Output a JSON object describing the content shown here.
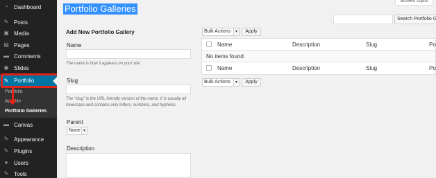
{
  "sidebar": {
    "items": [
      {
        "label": "Dashboard",
        "icon": "dashboard-icon",
        "glyph": "◔"
      },
      {
        "label": "Posts",
        "icon": "pin-icon",
        "glyph": "✎"
      },
      {
        "label": "Media",
        "icon": "media-icon",
        "glyph": "▣"
      },
      {
        "label": "Pages",
        "icon": "pages-icon",
        "glyph": "▤"
      },
      {
        "label": "Comments",
        "icon": "comments-icon",
        "glyph": "▬"
      },
      {
        "label": "Slides",
        "icon": "slides-icon",
        "glyph": "◉"
      },
      {
        "label": "Portfolio",
        "icon": "portfolio-icon",
        "glyph": "✎"
      },
      {
        "label": "Canvas",
        "icon": "canvas-icon",
        "glyph": "▬"
      },
      {
        "label": "Appearance",
        "icon": "appearance-icon",
        "glyph": "✎"
      },
      {
        "label": "Plugins",
        "icon": "plugins-icon",
        "glyph": "✎"
      },
      {
        "label": "Users",
        "icon": "users-icon",
        "glyph": "●"
      },
      {
        "label": "Tools",
        "icon": "tools-icon",
        "glyph": "✎"
      }
    ],
    "submenu": [
      "Portfolio",
      "Add Ne",
      "Portfolio Galleries"
    ]
  },
  "header": {
    "title": "Portfolio Galleries",
    "screen_options": "Screen Optio"
  },
  "search": {
    "button": "Search Portfolio Ga"
  },
  "form": {
    "title": "Add New Portfolio Gallery",
    "name_label": "Name",
    "name_hint": "The name is how it appears on your site.",
    "slug_label": "Slug",
    "slug_hint": "The “slug” is the URL-friendly version of the name. It is usually all lowercase and contains only letters, numbers, and hyphens.",
    "parent_label": "Parent",
    "parent_value": "None",
    "description_label": "Description"
  },
  "bulk": {
    "select_value": "Bulk Actions",
    "apply_label": "Apply"
  },
  "table": {
    "columns": [
      "Name",
      "Description",
      "Slug",
      "Po"
    ],
    "empty_message": "No items found."
  },
  "colors": {
    "sidebar_bg": "#222222",
    "active_blue": "#0074a2",
    "annotation_red": "#e2231a",
    "title_highlight": "#3390ff"
  }
}
